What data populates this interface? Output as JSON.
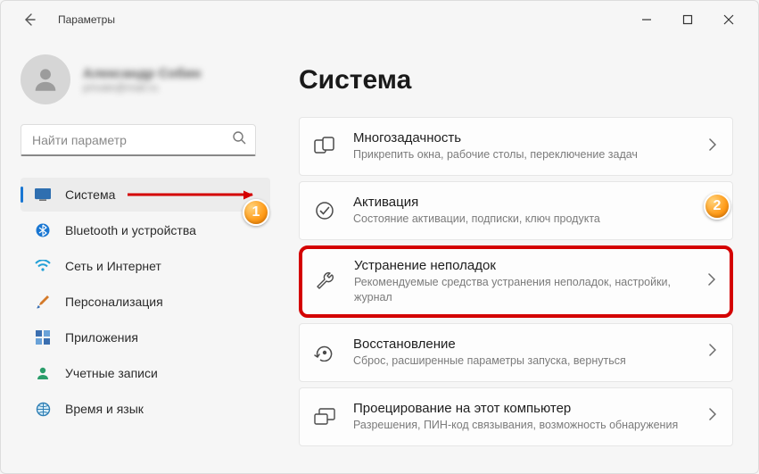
{
  "app_title": "Параметры",
  "profile": {
    "name": "Александр Собин",
    "email": "private@mail.ru"
  },
  "search": {
    "placeholder": "Найти параметр"
  },
  "nav": {
    "items": [
      {
        "label": "Система"
      },
      {
        "label": "Bluetooth и устройства"
      },
      {
        "label": "Сеть и Интернет"
      },
      {
        "label": "Персонализация"
      },
      {
        "label": "Приложения"
      },
      {
        "label": "Учетные записи"
      },
      {
        "label": "Время и язык"
      }
    ]
  },
  "page": {
    "title": "Система",
    "cards": [
      {
        "title": "Многозадачность",
        "sub": "Прикрепить окна, рабочие столы, переключение задач"
      },
      {
        "title": "Активация",
        "sub": "Состояние активации, подписки, ключ продукта"
      },
      {
        "title": "Устранение неполадок",
        "sub": "Рекомендуемые средства устранения неполадок, настройки, журнал"
      },
      {
        "title": "Восстановление",
        "sub": "Сброс, расширенные параметры запуска, вернуться"
      },
      {
        "title": "Проецирование на этот компьютер",
        "sub": "Разрешения, ПИН-код связывания, возможность обнаружения"
      }
    ]
  },
  "callouts": {
    "one": "1",
    "two": "2"
  }
}
